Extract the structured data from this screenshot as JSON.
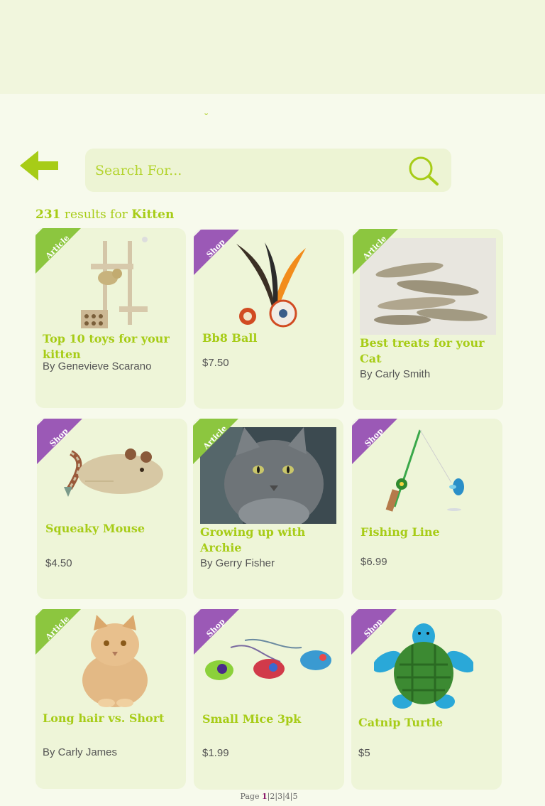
{
  "search": {
    "placeholder": "Search For..."
  },
  "results": {
    "count": "231",
    "middle": " results for ",
    "term": "Kitten"
  },
  "cards": [
    {
      "badge": "Article",
      "title_lines": [
        "Top 10 toys for your",
        "kitten"
      ],
      "meta": "By Genevieve Scarano"
    },
    {
      "badge": "Shop",
      "title_lines": [
        "Bb8 Ball"
      ],
      "meta": "$7.50"
    },
    {
      "badge": "Article",
      "title_lines": [
        "Best treats for your",
        "Cat"
      ],
      "meta": "By Carly Smith"
    },
    {
      "badge": "Shop",
      "title_lines": [
        "Squeaky Mouse"
      ],
      "meta": "$4.50"
    },
    {
      "badge": "Article",
      "title_lines": [
        "Growing up with",
        "Archie"
      ],
      "meta": "By Gerry Fisher"
    },
    {
      "badge": "Shop",
      "title_lines": [
        "Fishing Line"
      ],
      "meta": "$6.99"
    },
    {
      "badge": "Article",
      "title_lines": [
        "Long hair vs. Short"
      ],
      "meta": "By Carly James"
    },
    {
      "badge": "Shop",
      "title_lines": [
        "Small Mice 3pk"
      ],
      "meta": "$1.99"
    },
    {
      "badge": "Shop",
      "title_lines": [
        "Catnip Turtle"
      ],
      "meta": "$5"
    }
  ],
  "pager": {
    "label": "Page ",
    "pages": [
      "1",
      "2",
      "3",
      "4",
      "5"
    ],
    "current": "1",
    "separator": "|"
  },
  "colors": {
    "accent": "#a7cc17",
    "article_badge": "#8cc63f",
    "shop_badge": "#9b59b6"
  }
}
